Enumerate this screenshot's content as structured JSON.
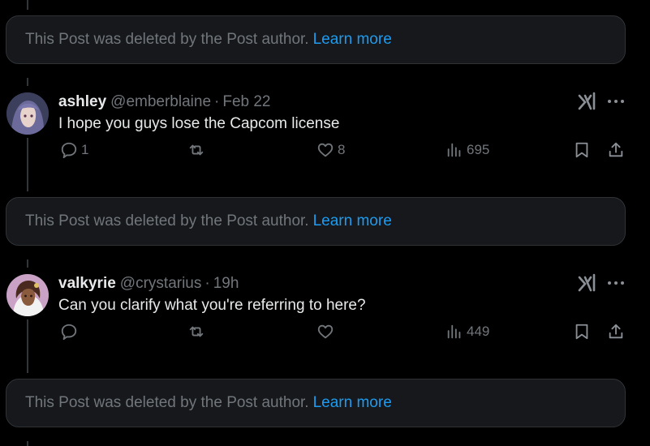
{
  "deleted_notice": {
    "text": "This Post was deleted by the Post author.",
    "link": "Learn more"
  },
  "posts": [
    {
      "name": "ashley",
      "handle": "@emberblaine",
      "separator": "·",
      "time": "Feb 22",
      "text": "I hope you guys lose the Capcom license",
      "replies": "1",
      "reposts": "",
      "likes": "8",
      "views": "695"
    },
    {
      "name": "valkyrie",
      "handle": "@crystarius",
      "separator": "·",
      "time": "19h",
      "text": "Can you clarify what you're referring to here?",
      "replies": "",
      "reposts": "",
      "likes": "",
      "views": "449"
    }
  ],
  "colors": {
    "background": "#000000",
    "card": "#16181c",
    "muted": "#71767b",
    "link": "#1d9bf0",
    "text": "#e7e9ea"
  },
  "icons": [
    "reply-icon",
    "repost-icon",
    "like-icon",
    "views-icon",
    "bookmark-icon",
    "share-icon",
    "grok-icon",
    "more-icon"
  ]
}
